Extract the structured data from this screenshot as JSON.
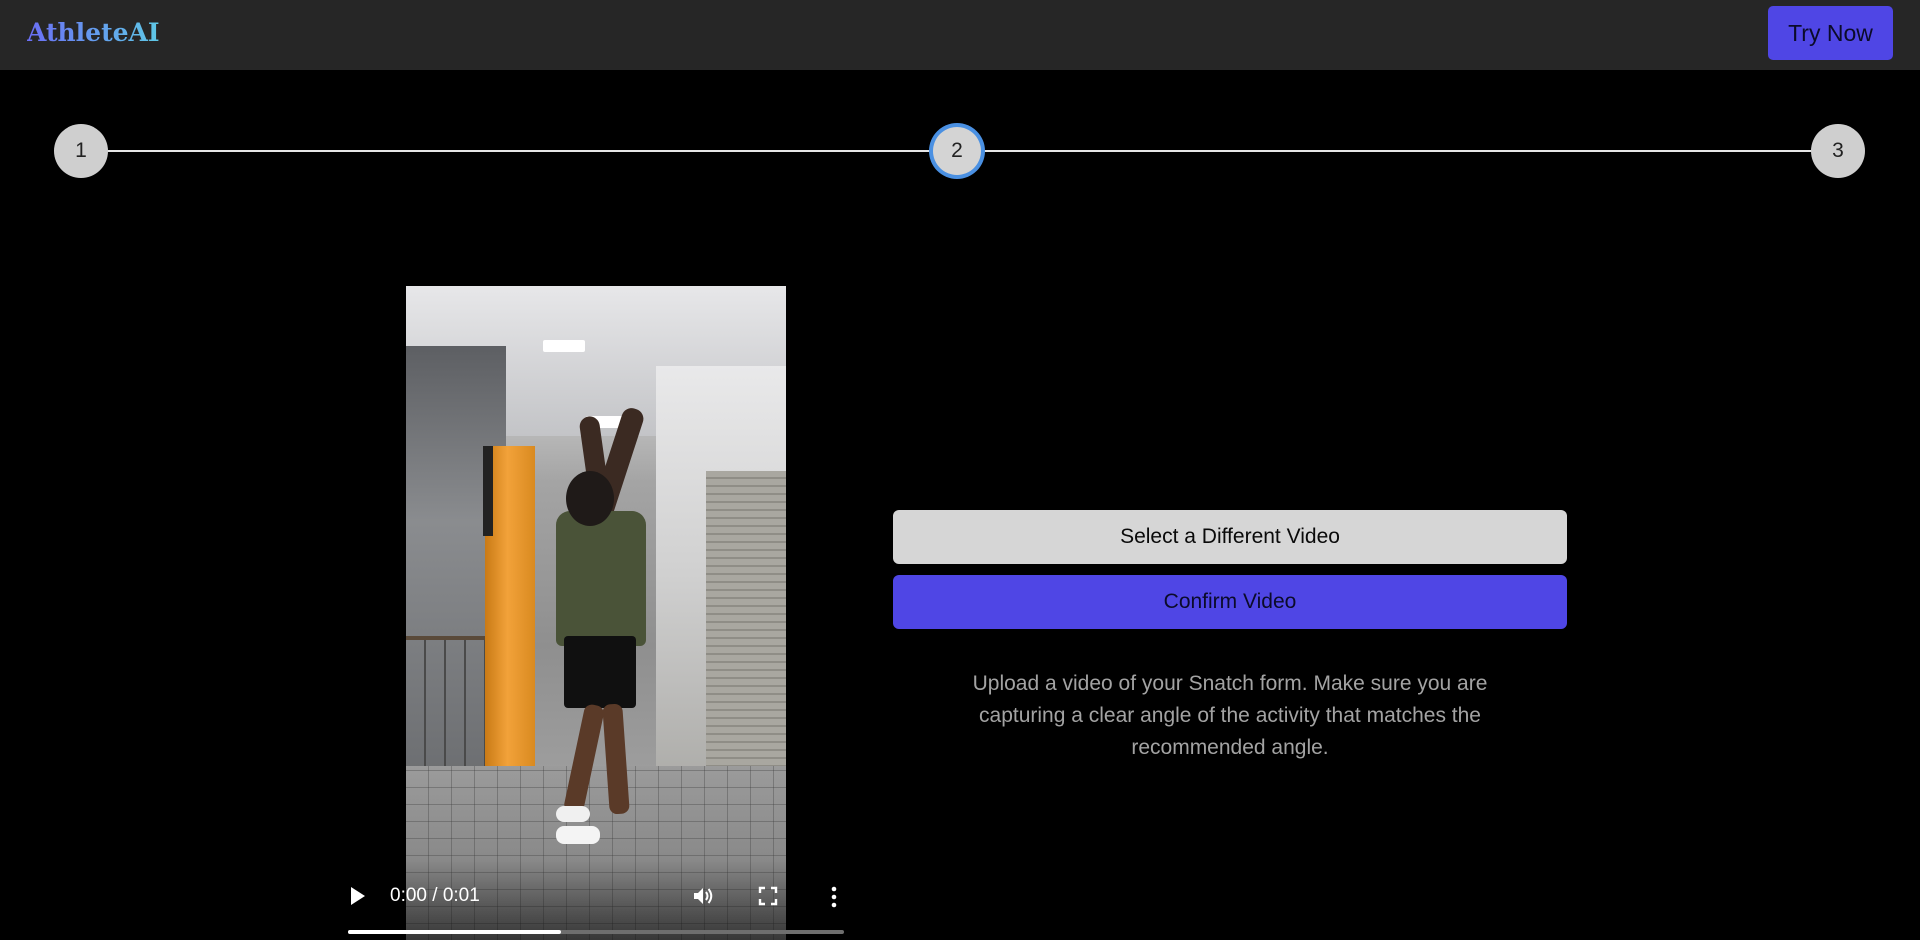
{
  "app": {
    "brand": "AthleteAI"
  },
  "header": {
    "cta_label": "Try Now"
  },
  "stepper": {
    "steps": [
      {
        "label": "1",
        "state": "default"
      },
      {
        "label": "2",
        "state": "active"
      },
      {
        "label": "3",
        "state": "default"
      }
    ]
  },
  "video": {
    "time_display": "0:00 / 0:01",
    "progress_fraction": 0.43,
    "icons": [
      "play-icon",
      "volume-icon",
      "fullscreen-icon",
      "more-options-icon"
    ]
  },
  "panel": {
    "select_label": "Select a Different Video",
    "confirm_label": "Confirm Video",
    "help_text": "Upload a video of your Snatch form. Make sure you are capturing a clear angle of the activity that matches the recommended angle."
  },
  "colors": {
    "accent": "#4f46e5",
    "active_ring": "#4a90e2",
    "navbar_bg": "#262626",
    "page_bg": "#000000"
  }
}
